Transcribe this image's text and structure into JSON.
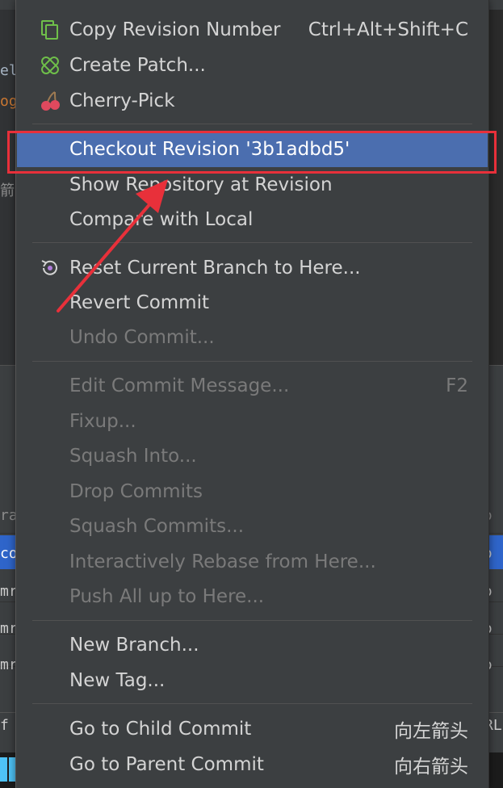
{
  "menu": {
    "items": [
      {
        "label": "Copy Revision Number",
        "shortcut": "Ctrl+Alt+Shift+C",
        "icon": "copy-icon",
        "enabled": true
      },
      {
        "label": "Create Patch...",
        "icon": "patch-icon",
        "enabled": true
      },
      {
        "label": "Cherry-Pick",
        "icon": "cherry-icon",
        "enabled": true
      },
      {
        "label": "Checkout Revision '3b1adbd5'",
        "enabled": true,
        "selected": true
      },
      {
        "label": "Show Repository at Revision",
        "enabled": true
      },
      {
        "label": "Compare with Local",
        "enabled": true
      },
      {
        "label": "Reset Current Branch to Here...",
        "icon": "reset-icon",
        "enabled": true
      },
      {
        "label": "Revert Commit",
        "enabled": true
      },
      {
        "label": "Undo Commit...",
        "enabled": false
      },
      {
        "label": "Edit Commit Message...",
        "shortcut": "F2",
        "enabled": false
      },
      {
        "label": "Fixup...",
        "enabled": false
      },
      {
        "label": "Squash Into...",
        "enabled": false
      },
      {
        "label": "Drop Commits",
        "enabled": false
      },
      {
        "label": "Squash Commits...",
        "enabled": false
      },
      {
        "label": "Interactively Rebase from Here...",
        "enabled": false
      },
      {
        "label": "Push All up to Here...",
        "enabled": false
      },
      {
        "label": "New Branch...",
        "enabled": true
      },
      {
        "label": "New Tag...",
        "enabled": true
      },
      {
        "label": "Go to Child Commit",
        "shortcut": "向左箭头",
        "enabled": true
      },
      {
        "label": "Go to Parent Commit",
        "shortcut": "向右箭头",
        "enabled": true
      }
    ]
  },
  "background": {
    "editor_fragments": [
      "el",
      "og"
    ],
    "cjk_fragment": "箭",
    "list_fragments": [
      "ra",
      "co",
      "mr",
      "mr",
      "mr"
    ],
    "status_fragment_left": "f n",
    "status_fragment_right": "RL"
  },
  "colors": {
    "menu_bg": "#3c3f41",
    "selection": "#4b6eaf",
    "annotation": "#e8303a",
    "disabled_text": "#7a7a7a"
  }
}
